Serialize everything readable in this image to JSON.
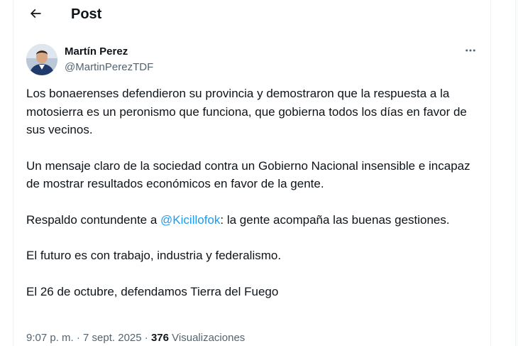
{
  "header": {
    "title": "Post"
  },
  "author": {
    "name": "Martín Perez",
    "handle": "@MartinPerezTDF"
  },
  "tweet": {
    "p1": "Los bonaerenses defendieron su provincia y demostraron que la respuesta a la motosierra es un peronismo que funciona, que gobierna todos los días en favor de sus vecinos.",
    "p2": "Un mensaje claro de la sociedad contra un Gobierno Nacional insensible e incapaz de mostrar resultados económicos en favor de la gente.",
    "p3_before": "Respaldo contundente a ",
    "p3_mention": "@Kicillofok",
    "p3_after": ": la gente acompaña las buenas gestiones.",
    "p4": "El futuro es con trabajo, industria y federalismo.",
    "p5": "El 26 de octubre, defendamos Tierra del Fuego"
  },
  "meta": {
    "time": "9:07 p. m.",
    "separator": " · ",
    "date": "7 sept. 2025",
    "views_count": "376",
    "views_label": " Visualizaciones"
  },
  "icons": {
    "back": "arrow-left-icon",
    "more": "more-horizontal-icon"
  },
  "colors": {
    "link": "#1d9bf0",
    "secondary_text": "#536471",
    "text": "#0f1419"
  }
}
